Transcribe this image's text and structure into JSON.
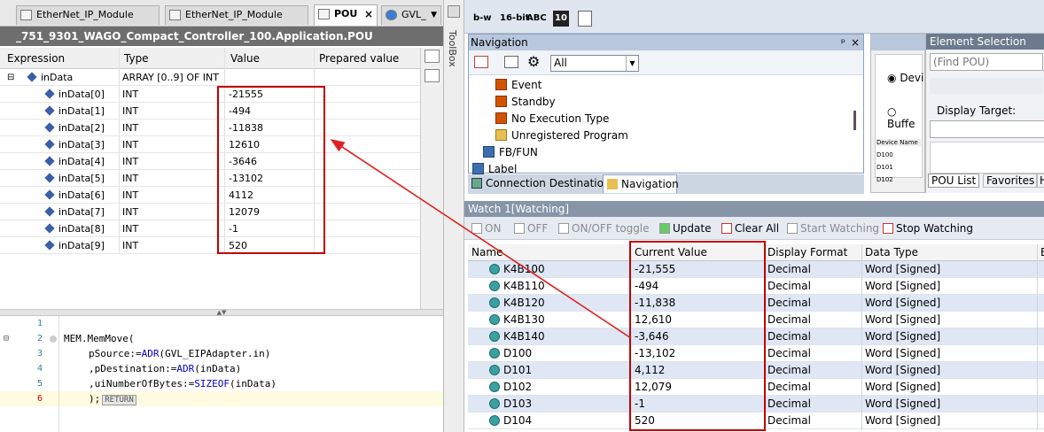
{
  "editor_tabs": [
    {
      "label": "EtherNet_IP_Module",
      "active": false
    },
    {
      "label": "EtherNet_IP_Module",
      "active": false
    },
    {
      "label": "POU",
      "active": true
    },
    {
      "label": "GVL_",
      "active": false
    }
  ],
  "pou_title": "_751_9301_WAGO_Compact_Controller_100.Application.POU",
  "watch_table": {
    "headers": {
      "expression": "Expression",
      "type": "Type",
      "value": "Value",
      "prepared": "Prepared value"
    },
    "parent": {
      "expression": "inData",
      "type": "ARRAY [0..9] OF INT",
      "expand": "⊟"
    },
    "rows": [
      {
        "expression": "inData[0]",
        "type": "INT",
        "value": "-21555"
      },
      {
        "expression": "inData[1]",
        "type": "INT",
        "value": "-494"
      },
      {
        "expression": "inData[2]",
        "type": "INT",
        "value": "-11838"
      },
      {
        "expression": "inData[3]",
        "type": "INT",
        "value": "12610"
      },
      {
        "expression": "inData[4]",
        "type": "INT",
        "value": "-3646"
      },
      {
        "expression": "inData[5]",
        "type": "INT",
        "value": "-13102"
      },
      {
        "expression": "inData[6]",
        "type": "INT",
        "value": "4112"
      },
      {
        "expression": "inData[7]",
        "type": "INT",
        "value": "12079"
      },
      {
        "expression": "inData[8]",
        "type": "INT",
        "value": "-1"
      },
      {
        "expression": "inData[9]",
        "type": "INT",
        "value": "520"
      }
    ]
  },
  "code": {
    "lines": [
      {
        "num": "1",
        "text": ""
      },
      {
        "num": "2",
        "text": "MEM.MemMove("
      },
      {
        "num": "3",
        "pre": "pSource:=",
        "kw": "ADR",
        "post": "(GVL_EIPAdapter.in)"
      },
      {
        "num": "4",
        "pre": ",pDestination:=",
        "kw": "ADR",
        "post": "(inData)"
      },
      {
        "num": "5",
        "pre": ",uiNumberOfBytes:=",
        "kw": "SIZEOF",
        "post": "(inData)"
      },
      {
        "num": "6",
        "text": ");"
      }
    ],
    "return_label": "RETURN"
  },
  "toolbox_label": "ToolBox",
  "toolbar": {
    "btn1": "b-w",
    "btn2": "16-bit",
    "btn3": "ABC",
    "btn4": "10"
  },
  "navigation": {
    "title": "Navigation",
    "pin": "ᵖ",
    "close": "×",
    "filter": "All",
    "items": [
      {
        "label": "Event",
        "icon": "program"
      },
      {
        "label": "Standby",
        "icon": "program"
      },
      {
        "label": "No Execution Type",
        "icon": "program"
      },
      {
        "label": "Unregistered Program",
        "icon": "program-folder"
      },
      {
        "label": "FB/FUN",
        "icon": "fb"
      },
      {
        "label": "Label",
        "icon": "label"
      }
    ],
    "tabs": [
      "Connection Destination",
      "Navigation"
    ]
  },
  "device_panel": {
    "radio1": "Devi",
    "radio2": "Buffe",
    "col_header": "Device Name",
    "rows": [
      "D100",
      "D101",
      "D102"
    ]
  },
  "element_selection": {
    "title": "Element Selection",
    "search_placeholder": "(Find POU)",
    "display_target": "Display Target:",
    "tabs": [
      "POU List",
      "Favorites",
      "H"
    ]
  },
  "watch1": {
    "title": "Watch 1[Watching]",
    "buttons": {
      "on": "ON",
      "off": "OFF",
      "toggle": "ON/OFF toggle",
      "update": "Update",
      "clear": "Clear All",
      "start": "Start Watching",
      "stop": "Stop Watching"
    },
    "headers": {
      "name": "Name",
      "current": "Current Value",
      "format": "Display Format",
      "dtype": "Data Type",
      "extra": "E"
    },
    "rows": [
      {
        "name": "K4B100",
        "value": "-21,555",
        "format": "Decimal",
        "dtype": "Word [Signed]"
      },
      {
        "name": "K4B110",
        "value": "-494",
        "format": "Decimal",
        "dtype": "Word [Signed]"
      },
      {
        "name": "K4B120",
        "value": "-11,838",
        "format": "Decimal",
        "dtype": "Word [Signed]"
      },
      {
        "name": "K4B130",
        "value": "12,610",
        "format": "Decimal",
        "dtype": "Word [Signed]"
      },
      {
        "name": "K4B140",
        "value": "-3,646",
        "format": "Decimal",
        "dtype": "Word [Signed]"
      },
      {
        "name": "D100",
        "value": "-13,102",
        "format": "Decimal",
        "dtype": "Word [Signed]"
      },
      {
        "name": "D101",
        "value": "4,112",
        "format": "Decimal",
        "dtype": "Word [Signed]"
      },
      {
        "name": "D102",
        "value": "12,079",
        "format": "Decimal",
        "dtype": "Word [Signed]"
      },
      {
        "name": "D103",
        "value": "-1",
        "format": "Decimal",
        "dtype": "Word [Signed]"
      },
      {
        "name": "D104",
        "value": "520",
        "format": "Decimal",
        "dtype": "Word [Signed]"
      }
    ]
  },
  "colors": {
    "highlight": "#c00000",
    "accent": "#3d6fb0"
  }
}
